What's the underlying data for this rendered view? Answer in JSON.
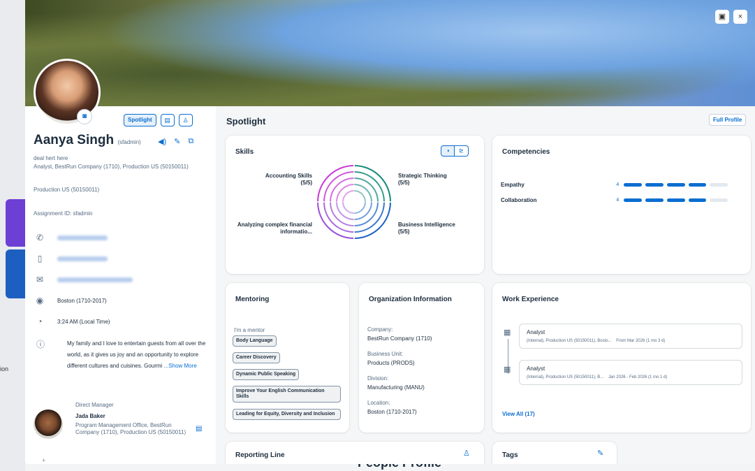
{
  "background": {
    "side_text": "ion",
    "page_title": "People Profile"
  },
  "cover": {
    "camera_icon": "camera-icon",
    "close_label": "×"
  },
  "profile": {
    "view_buttons": [
      "Spotlight"
    ],
    "name": "Aanya Singh",
    "username": "(sfadmin)",
    "tagline": "deal hert here",
    "position": "Analyst, BestRun Company (1710), Production US (50150011)",
    "department": "Production US (50150011)",
    "assignment": "Assignment ID: sfadmin",
    "location": "Boston (1710-2017)",
    "local_time": "3:24 AM (Local Time)",
    "about": "My family and I love to entertain guests from all over the world, as it gives us joy and an opportunity to explore different cultures and cuisines. Gourmi",
    "show_more": "...Show More",
    "manager": {
      "label": "Direct Manager",
      "name": "Jada Baker",
      "org": "Program Management Office, BestRun Company (1710), Production US (50150011)"
    }
  },
  "spotlight": {
    "title": "Spotlight",
    "full_profile": "Full Profile",
    "skills": {
      "title": "Skills",
      "items": [
        {
          "name": "Accounting Skills",
          "level": "(5/5)",
          "color": "#c83ad6"
        },
        {
          "name": "Strategic Thinking",
          "level": "(5/5)",
          "color": "#118a7a"
        },
        {
          "name": "Analyzing complex financial informatio...",
          "level": "",
          "color": "#9b50d8"
        },
        {
          "name": "Business Intelligence",
          "level": "(5/5)",
          "color": "#1c63c6"
        }
      ]
    },
    "competencies": {
      "title": "Competencies",
      "items": [
        {
          "name": "Empathy",
          "value": "4",
          "rating": 4,
          "max": 5
        },
        {
          "name": "Collaboration",
          "value": "4",
          "rating": 4,
          "max": 5
        }
      ]
    },
    "mentoring": {
      "title": "Mentoring",
      "subtitle": "I'm a mentor",
      "topics": [
        "Body Language",
        "Career Discovery",
        "Dynamic Public Speaking",
        "Improve Your English Communication Skills",
        "Leading for Equity, Diversity and Inclusion"
      ]
    },
    "organization": {
      "title": "Organization Information",
      "fields": [
        {
          "label": "Company:",
          "value": "BestRun Company (1710)"
        },
        {
          "label": "Business Unit:",
          "value": "Products (PRODS)"
        },
        {
          "label": "Division:",
          "value": "Manufacturing (MANU)"
        },
        {
          "label": "Location:",
          "value": "Boston (1710-2017)"
        }
      ]
    },
    "work_experience": {
      "title": "Work Experience",
      "items": [
        {
          "title": "Analyst",
          "detail": "(Internal), Production US (50150011), Bosto...",
          "dates": "From Mar 2026 (1 mo 3 d)"
        },
        {
          "title": "Analyst",
          "detail": "(Internal), Production US (50150011), B...",
          "dates": "Jan 2026 - Feb 2026 (1 mo 1 d)"
        }
      ],
      "view_all": "View All (17)"
    },
    "reporting_line": {
      "title": "Reporting Line"
    },
    "tags": {
      "title": "Tags"
    }
  }
}
